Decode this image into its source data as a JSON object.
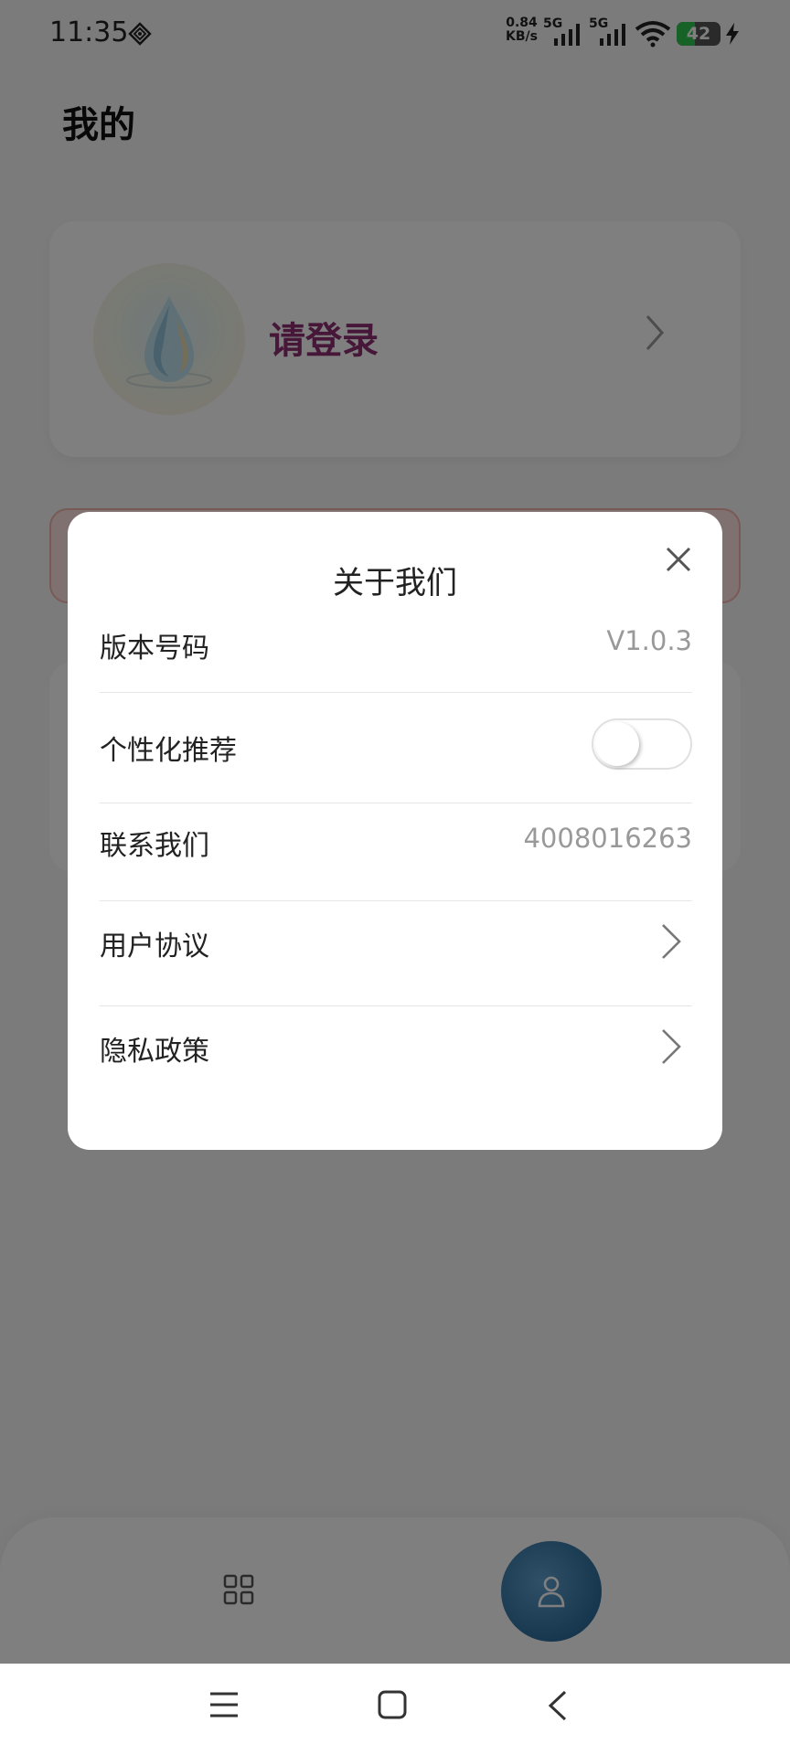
{
  "status_bar": {
    "time": "11:35",
    "net_speed_value": "0.84",
    "net_speed_unit": "KB/s",
    "sim1_network": "5G",
    "sim2_network": "5G",
    "wifi_badge": "6",
    "battery_level": "42",
    "battery_fraction": 0.42,
    "battery_color": "#2ec54f"
  },
  "page": {
    "title": "我的",
    "login_prompt": "请登录",
    "login_color": "#8e2f72"
  },
  "dialog": {
    "title": "关于我们",
    "rows": [
      {
        "label": "版本号码",
        "value": "V1.0.3"
      },
      {
        "label": "个性化推荐",
        "toggle_on": false
      },
      {
        "label": "联系我们",
        "value": "4008016263"
      },
      {
        "label": "用户协议",
        "icon": "chevron-right-icon"
      },
      {
        "label": "隐私政策",
        "icon": "chevron-right-icon"
      }
    ]
  },
  "tab_bar": {
    "items": [
      {
        "icon": "grid-icon",
        "active": false
      },
      {
        "icon": "person-icon",
        "active": true
      }
    ],
    "accent_color": "#2f6f9e"
  },
  "nav_bar": {
    "icons": [
      "menu-icon",
      "home-square-icon",
      "back-arrow-icon"
    ]
  }
}
